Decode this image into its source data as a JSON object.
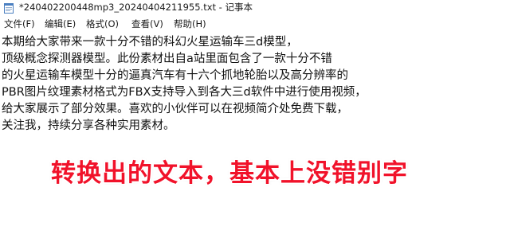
{
  "window": {
    "title": "*240402200448mp3_20240404211955.txt - 记事本",
    "app_icon": "notepad-icon"
  },
  "menu": {
    "items": [
      {
        "label": "文件(F)"
      },
      {
        "label": "编辑(E)"
      },
      {
        "label": "格式(O)"
      },
      {
        "label": "查看(V)"
      },
      {
        "label": "帮助(H)"
      }
    ]
  },
  "editor": {
    "lines": [
      "本期给大家带来一款十分不错的科幻火星运输车三d模型，",
      "顶级概念探测器模型。此份素材出自a站里面包含了一款十分不错",
      "的火星运输车模型十分的逼真汽车有十六个抓地轮胎以及高分辨率的",
      "PBR图片纹理素材格式为FBX支持导入到各大三d软件中进行使用视频，",
      "给大家展示了部分效果。喜欢的小伙伴可以在视频简介处免费下载，",
      "关注我，持续分享各种实用素材。"
    ]
  },
  "overlay": {
    "caption": "转换出的文本，基本上没错别字",
    "color": "#f1122a"
  }
}
